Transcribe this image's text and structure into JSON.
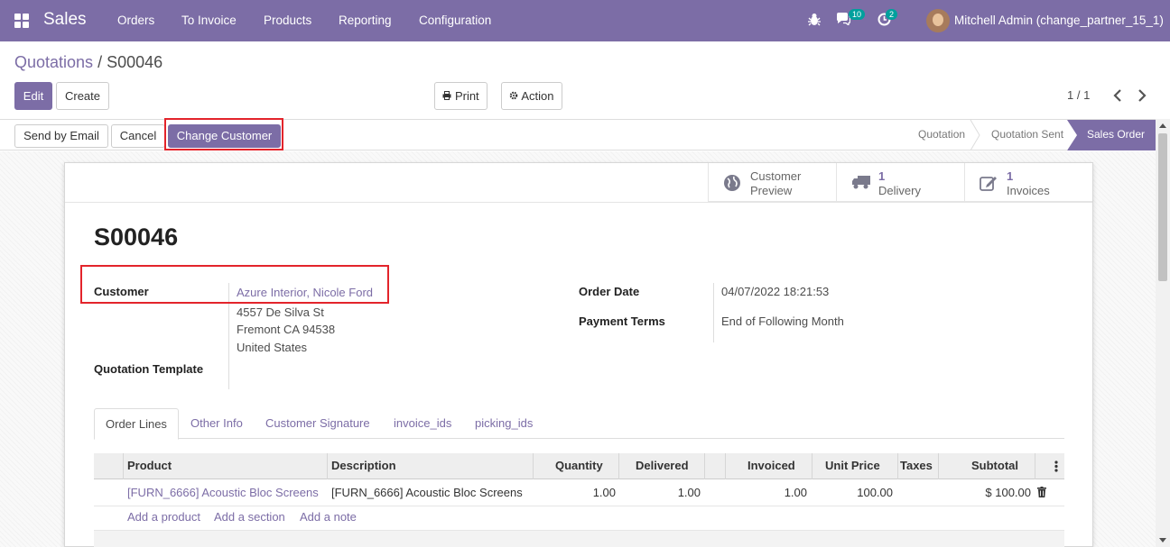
{
  "navbar": {
    "app_name": "Sales",
    "menus": [
      "Orders",
      "To Invoice",
      "Products",
      "Reporting",
      "Configuration"
    ],
    "messages_count": "10",
    "activities_count": "2",
    "user": "Mitchell Admin (change_partner_15_1)"
  },
  "breadcrumb": {
    "parent": "Quotations",
    "separator": "/",
    "current": "S00046"
  },
  "control": {
    "edit": "Edit",
    "create": "Create",
    "print": "Print",
    "action": "Action",
    "pager": "1 / 1"
  },
  "statusbar": {
    "send_email": "Send by Email",
    "cancel": "Cancel",
    "change_customer": "Change Customer",
    "stages": [
      "Quotation",
      "Quotation Sent",
      "Sales Order"
    ],
    "active_stage": "Sales Order"
  },
  "smart_buttons": {
    "preview_line1": "Customer",
    "preview_line2": "Preview",
    "delivery_count": "1",
    "delivery_label": "Delivery",
    "invoices_count": "1",
    "invoices_label": "Invoices"
  },
  "form": {
    "name": "S00046",
    "customer_label": "Customer",
    "customer_name": "Azure Interior, Nicole Ford",
    "address_line1": "4557 De Silva St",
    "address_line2": "Fremont CA 94538",
    "address_line3": "United States",
    "template_label": "Quotation Template",
    "order_date_label": "Order Date",
    "order_date": "04/07/2022 18:21:53",
    "payment_terms_label": "Payment Terms",
    "payment_terms": "End of Following Month"
  },
  "tabs": [
    "Order Lines",
    "Other Info",
    "Customer Signature",
    "invoice_ids",
    "picking_ids"
  ],
  "order_lines": {
    "columns": [
      "Product",
      "Description",
      "Quantity",
      "Delivered",
      "Invoiced",
      "Unit Price",
      "Taxes",
      "Subtotal"
    ],
    "rows": [
      {
        "product": "[FURN_6666] Acoustic Bloc Screens",
        "description": "[FURN_6666] Acoustic Bloc Screens",
        "quantity": "1.00",
        "delivered": "1.00",
        "invoiced": "1.00",
        "unit_price": "100.00",
        "taxes": "",
        "subtotal": "$ 100.00"
      }
    ],
    "add_product": "Add a product",
    "add_section": "Add a section",
    "add_note": "Add a note"
  },
  "colors": {
    "brand": "#7c6da6",
    "highlight": "#e3242b"
  }
}
